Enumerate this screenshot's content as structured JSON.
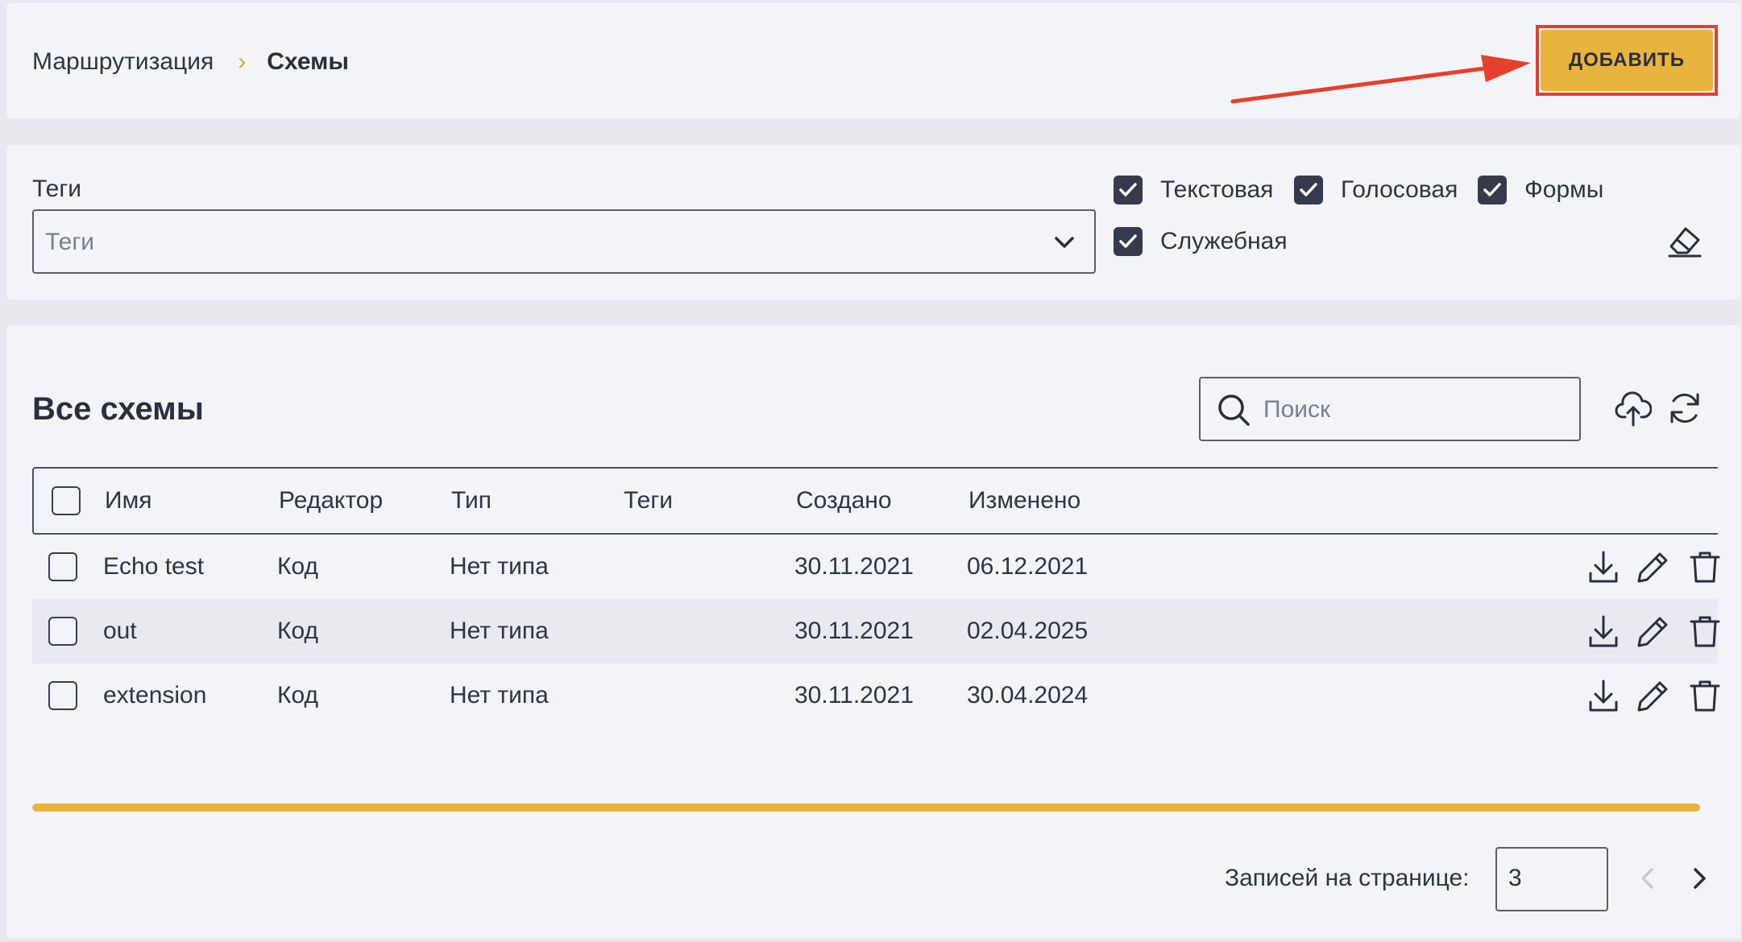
{
  "breadcrumb": {
    "parent": "Маршрутизация",
    "separator": "›",
    "current": "Схемы"
  },
  "header": {
    "add_label": "ДОБАВИТЬ"
  },
  "filters": {
    "tags_label": "Теги",
    "tags_placeholder": "Теги",
    "checkboxes": [
      {
        "label": "Текстовая",
        "checked": true
      },
      {
        "label": "Голосовая",
        "checked": true
      },
      {
        "label": "Формы",
        "checked": true
      },
      {
        "label": "Служебная",
        "checked": true
      }
    ]
  },
  "table": {
    "title": "Все схемы",
    "search_placeholder": "Поиск",
    "columns": [
      "Имя",
      "Редактор",
      "Тип",
      "Теги",
      "Создано",
      "Изменено"
    ],
    "rows": [
      {
        "name": "Echo test",
        "editor": "Код",
        "type": "Нет типа",
        "tags": "",
        "created": "30.11.2021",
        "modified": "06.12.2021"
      },
      {
        "name": "out",
        "editor": "Код",
        "type": "Нет типа",
        "tags": "",
        "created": "30.11.2021",
        "modified": "02.04.2025"
      },
      {
        "name": "extension",
        "editor": "Код",
        "type": "Нет типа",
        "tags": "",
        "created": "30.11.2021",
        "modified": "30.04.2024"
      }
    ]
  },
  "pagination": {
    "label": "Записей на странице:",
    "per_page": "3"
  },
  "colors": {
    "accent": "#e8b43e",
    "checkbox": "#353a4c",
    "highlight": "#e5402d",
    "text": "#2a2f3b"
  },
  "icons": [
    "chevron-right-icon",
    "arrow-annotation-icon",
    "chevron-down-icon",
    "check-icon",
    "eraser-icon",
    "search-icon",
    "upload-icon",
    "refresh-icon",
    "download-icon",
    "edit-icon",
    "trash-icon",
    "chevron-left-icon"
  ]
}
